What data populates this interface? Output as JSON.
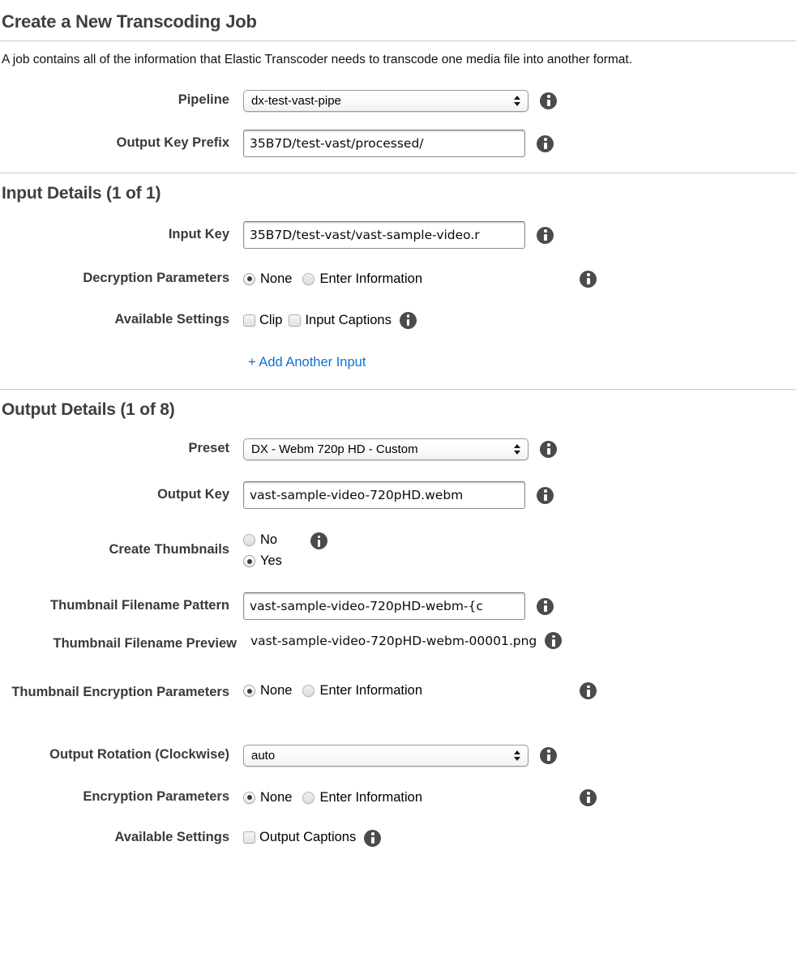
{
  "page": {
    "title": "Create a New Transcoding Job",
    "intro": "A job contains all of the information that Elastic Transcoder needs to transcode one media file into another format."
  },
  "job_settings": {
    "pipeline": {
      "label": "Pipeline",
      "value": "dx-test-vast-pipe",
      "control": "select",
      "info_icon": "info-icon"
    },
    "output_key_prefix": {
      "label": "Output Key Prefix",
      "value": "35B7D/test-vast/processed/",
      "control": "text-input",
      "info_icon": "info-icon"
    }
  },
  "input_details": {
    "heading": "Input Details (1 of 1)",
    "input_key": {
      "label": "Input Key",
      "value": "35B7D/test-vast/vast-sample-video.r",
      "control": "text-input"
    },
    "decryption_parameters": {
      "label": "Decryption Parameters",
      "options": [
        "None",
        "Enter Information"
      ],
      "selected": "None"
    },
    "available_settings": {
      "label": "Available Settings",
      "checkboxes": [
        {
          "label": "Clip",
          "checked": false
        },
        {
          "label": "Input Captions",
          "checked": false
        }
      ]
    },
    "add_another": "+ Add Another Input"
  },
  "output_details": {
    "heading": "Output Details (1 of 8)",
    "preset": {
      "label": "Preset",
      "value": "DX - Webm 720p HD - Custom",
      "control": "select"
    },
    "output_key": {
      "label": "Output Key",
      "value": "vast-sample-video-720pHD.webm",
      "control": "text-input"
    },
    "create_thumbnails": {
      "label": "Create Thumbnails",
      "options": [
        "No",
        "Yes"
      ],
      "selected": "Yes"
    },
    "thumbnail_filename_pattern": {
      "label": "Thumbnail Filename Pattern",
      "value": "vast-sample-video-720pHD-webm-{c",
      "control": "text-input"
    },
    "thumbnail_filename_preview": {
      "label": "Thumbnail Filename Preview",
      "value": "vast-sample-video-720pHD-webm-00001.png"
    },
    "thumbnail_encryption_parameters": {
      "label": "Thumbnail Encryption Parameters",
      "options": [
        "None",
        "Enter Information"
      ],
      "selected": "None"
    },
    "output_rotation": {
      "label": "Output Rotation (Clockwise)",
      "value": "auto",
      "control": "select"
    },
    "encryption_parameters": {
      "label": "Encryption Parameters",
      "options": [
        "None",
        "Enter Information"
      ],
      "selected": "None"
    },
    "available_settings": {
      "label": "Available Settings",
      "checkboxes": [
        {
          "label": "Output Captions",
          "checked": false
        }
      ]
    }
  },
  "colors": {
    "heading": "#3f3f3f",
    "link": "#1070d8",
    "info_icon": "#4b4b4b",
    "rule": "#c9c9c9"
  }
}
